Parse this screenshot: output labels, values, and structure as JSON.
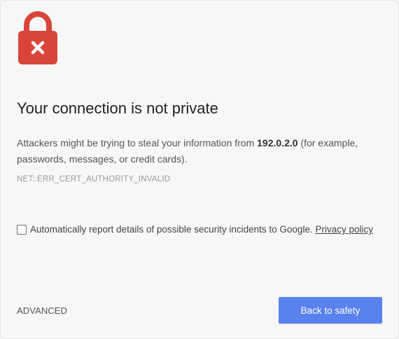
{
  "icon": {
    "name": "lock-error-icon",
    "color": "#db4437"
  },
  "heading": "Your connection is not private",
  "description": {
    "prefix": "Attackers might be trying to steal your information from ",
    "host": "192.0.2.0",
    "suffix": " (for example, passwords, messages, or credit cards)."
  },
  "error_code": "NET::ERR_CERT_AUTHORITY_INVALID",
  "report": {
    "checked": false,
    "label": "Automatically report details of possible security incidents to Google. ",
    "link_label": "Privacy policy"
  },
  "actions": {
    "advanced_label": "ADVANCED",
    "back_label": "Back to safety",
    "primary_color": "#5a82ee"
  }
}
